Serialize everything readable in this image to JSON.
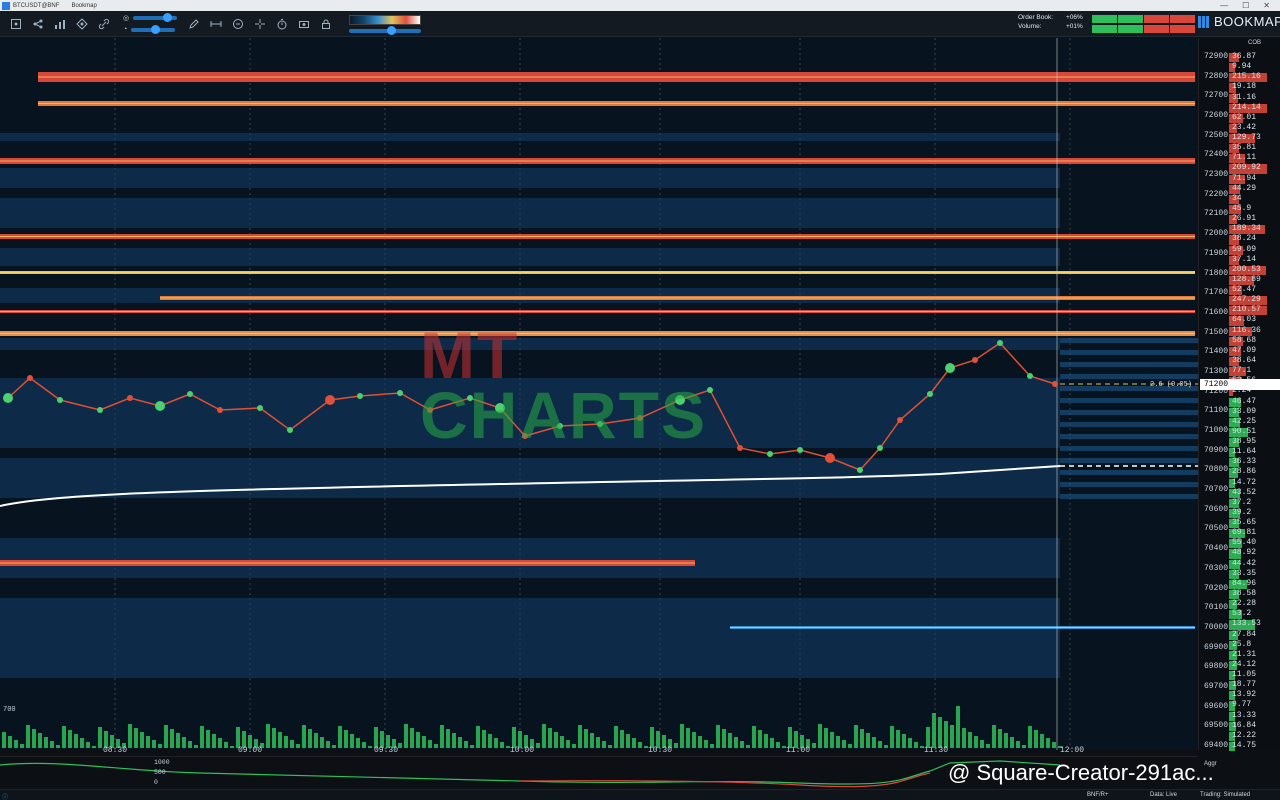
{
  "window": {
    "title_symbol": "BTCUSDT@BNF",
    "title_app": "Bookmap",
    "minimize": "—",
    "maximize": "☐",
    "close": "✕"
  },
  "toolbar": {
    "icons": [
      "settings-icon",
      "network-icon",
      "chart-icon",
      "indicators-icon",
      "link-icon",
      "sliders-icon",
      "pen-icon",
      "ruler-icon",
      "comment-icon",
      "crosshair-icon",
      "stopwatch-icon",
      "camera-icon",
      "lock-icon"
    ]
  },
  "stats": {
    "order_book_label": "Order Book:",
    "order_book_value": "+06%",
    "volume_label": "Volume:",
    "volume_value": "+01%"
  },
  "brand": {
    "name": "BOOKMAP"
  },
  "axis": {
    "cob_label": "COB",
    "prices": [
      "72900",
      "72800",
      "72700",
      "72600",
      "72500",
      "72400",
      "72300",
      "72200",
      "72100",
      "72000",
      "71900",
      "71800",
      "71700",
      "71600",
      "71500",
      "71400",
      "71300",
      "71200",
      "71100",
      "71000",
      "70900",
      "70800",
      "70700",
      "70600",
      "70500",
      "70400",
      "70300",
      "70200",
      "70100",
      "70000",
      "69900",
      "69800",
      "69700",
      "69600",
      "69500",
      "69400"
    ],
    "cob_values": [
      "36.87",
      "9.94",
      "215.16",
      "19.18",
      "31.16",
      "214.14",
      "62.01",
      "23.42",
      "129.73",
      "35.81",
      "71.11",
      "209.92",
      "71.94",
      "44.29",
      "34",
      "45.9",
      "26.91",
      "189.34",
      "38.24",
      "59.09",
      "37.14",
      "200.53",
      "128.89",
      "52.47",
      "247.29",
      "210.57",
      "64.03",
      "116.36",
      "58.68",
      "47.09",
      "38.64",
      "77.1",
      "52.56",
      "2.24",
      "46.47",
      "33.09",
      "42.25",
      "90.51",
      "38.95",
      "11.64",
      "36.33",
      "28.86",
      "14.72",
      "43.52",
      "37.2",
      "39.2",
      "35.65",
      "69.81",
      "55.40",
      "48.92",
      "44.42",
      "33.35",
      "84.96",
      "38.58",
      "22.28",
      "53.2",
      "133.53",
      "27.84",
      "25.8",
      "21.31",
      "24.12",
      "11.05",
      "18.77",
      "13.92",
      "9.77",
      "13.33",
      "16.84",
      "12.22",
      "14.75"
    ],
    "last_price": "71200",
    "last_price_delta": "2.6 (0.05)"
  },
  "time_axis": [
    "08:30",
    "09:00",
    "09:30",
    "10:00",
    "10:30",
    "11:00",
    "11:30",
    "12:00"
  ],
  "volume_axis_label": "700",
  "sub_indicator": {
    "labels": [
      "1000",
      "500",
      "0"
    ],
    "mode": "Aggr"
  },
  "status": {
    "feed": "BNF/R+",
    "data": "Data: Live",
    "trading": "Trading: Simulated"
  },
  "watermark": {
    "text": "@ Square-Creator-291ac...",
    "logo_mt": "MT",
    "logo_charts": "CHARTS"
  },
  "colors": {
    "bid": "#2ebf5a",
    "ask": "#d8473a",
    "heat_hot": "#e1513a",
    "heat_warm": "#e0c35a",
    "heat_cold": "#3b8fd0",
    "vwap": "#ffffff"
  }
}
